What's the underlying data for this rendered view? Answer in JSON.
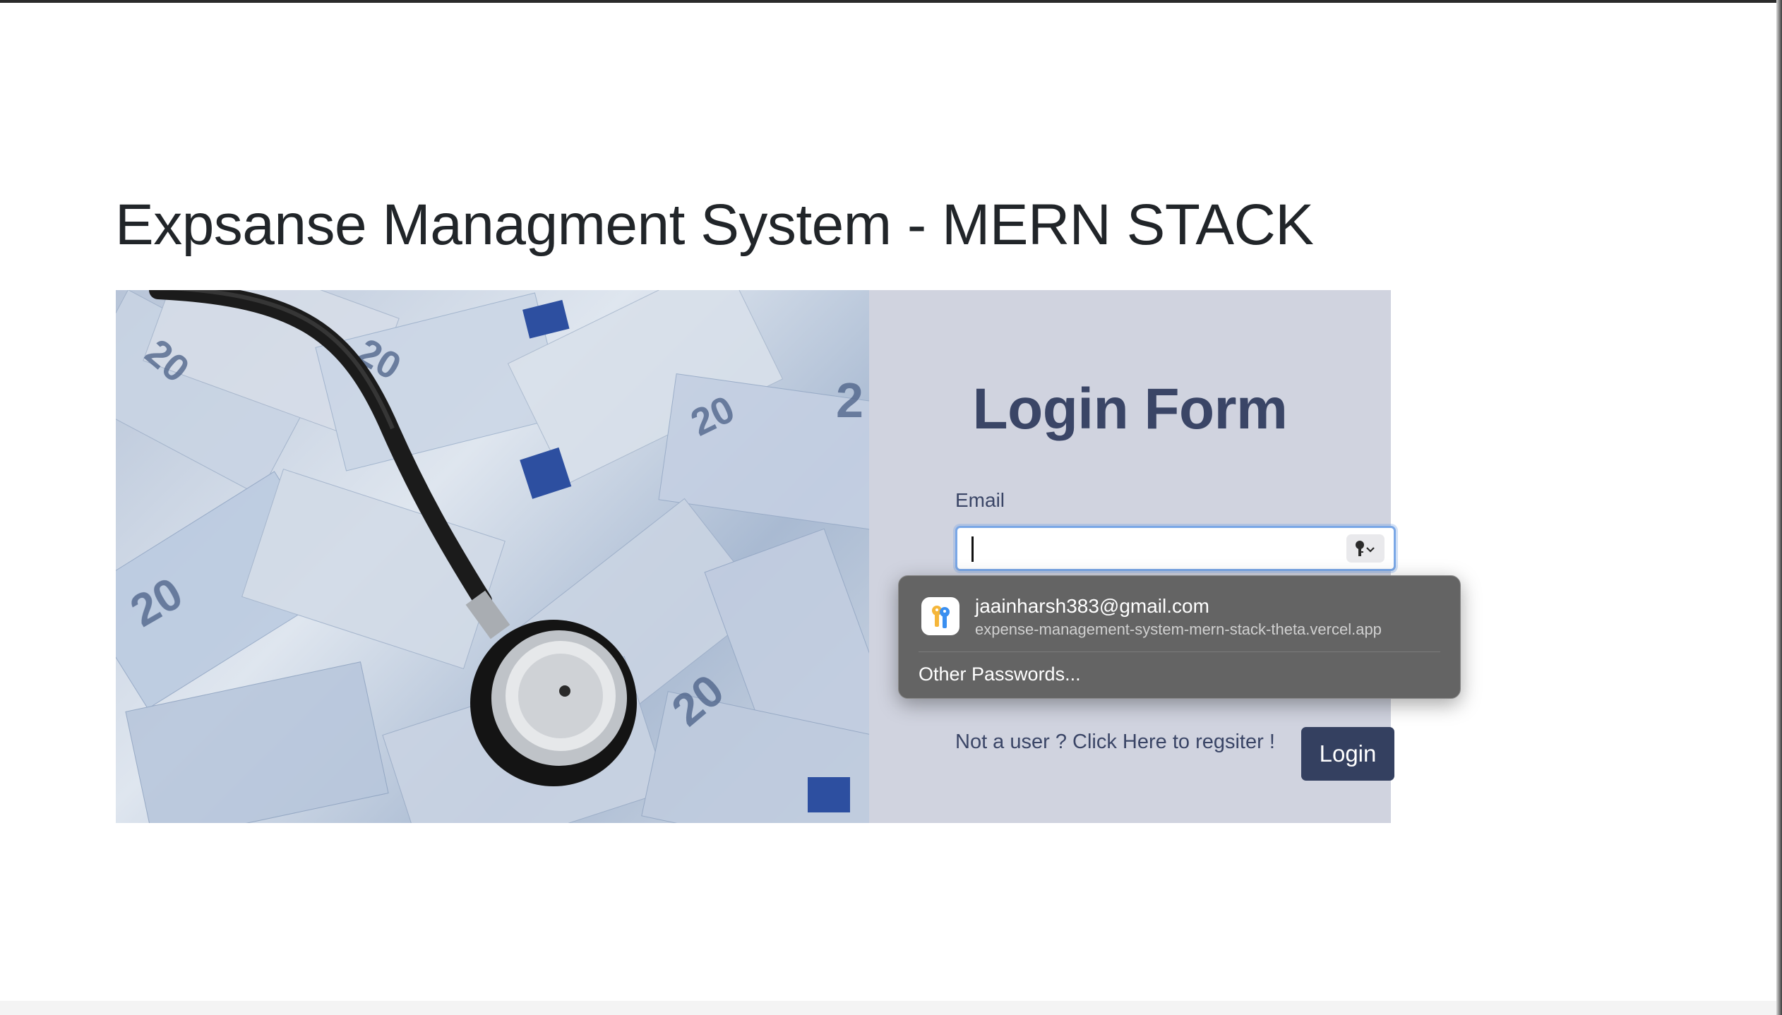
{
  "page": {
    "title": "Expsanse Managment System - MERN STACK"
  },
  "image": {
    "icon": "stethoscope-on-euro-banknotes-photo"
  },
  "form": {
    "title": "Login Form",
    "email_label": "Email",
    "email_value": "",
    "register_link": "Not a user ? Click Here to regsiter !",
    "login_button": "Login"
  },
  "autofill": {
    "email": "jaainharsh383@gmail.com",
    "site": "expense-management-system-mern-stack-theta.vercel.app",
    "other_passwords": "Other Passwords...",
    "icon": "passwords-key-icon"
  },
  "colors": {
    "form_panel": "#d0d3df",
    "accent": "#344060",
    "title_text": "#3a4566",
    "autofill_bg": "#646464"
  }
}
